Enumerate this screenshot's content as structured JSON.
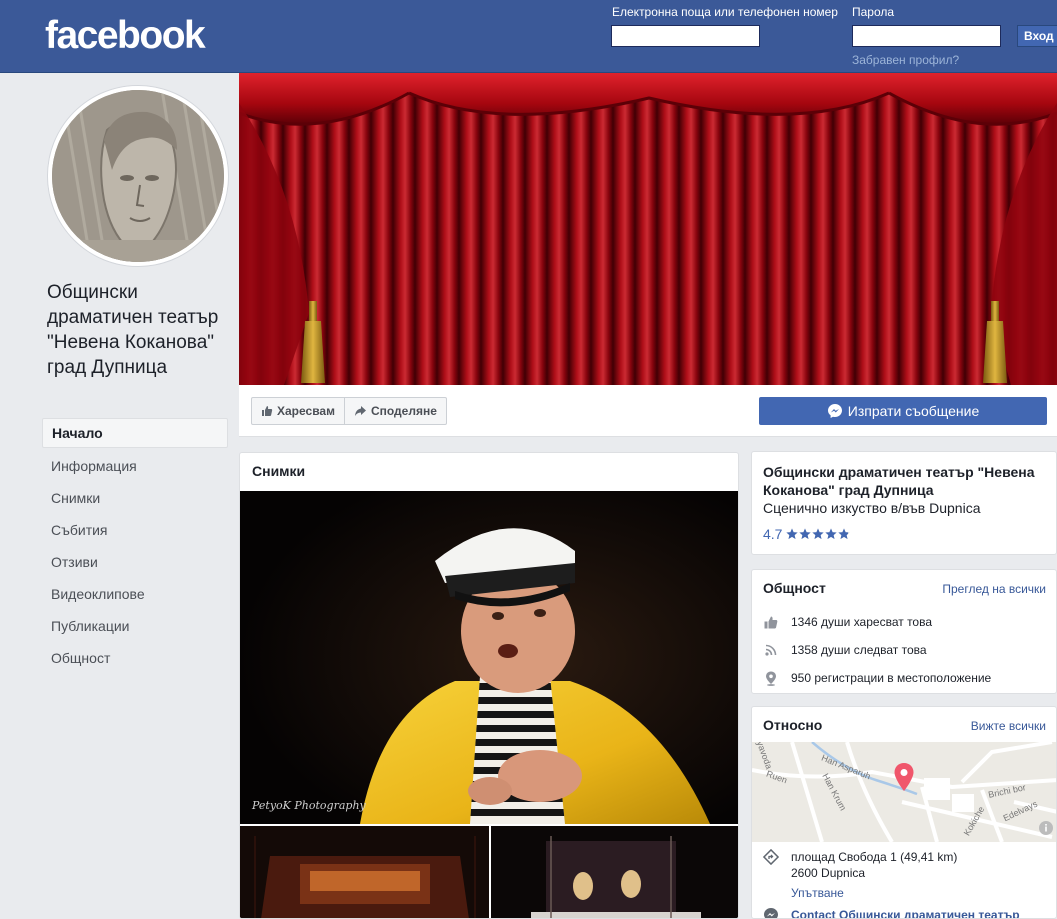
{
  "header": {
    "logo": "facebook",
    "email_label": "Електронна поща или телефонен номер",
    "password_label": "Парола",
    "forgot_link": "Забравен профил?",
    "login_button": "Вход"
  },
  "page": {
    "name": "Общински драматичен театър \"Невена Коканова\" град Дупница"
  },
  "nav": {
    "items": [
      {
        "label": "Начало"
      },
      {
        "label": "Информация"
      },
      {
        "label": "Снимки"
      },
      {
        "label": "Събития"
      },
      {
        "label": "Отзиви"
      },
      {
        "label": "Видеоклипове"
      },
      {
        "label": "Публикации"
      },
      {
        "label": "Общност"
      }
    ]
  },
  "actions": {
    "like_label": "Харесвам",
    "share_label": "Споделяне",
    "message_label": "Изпрати съобщение"
  },
  "photos": {
    "title": "Снимки",
    "watermark": "PetyoK Photography"
  },
  "info": {
    "title": "Общински драматичен театър \"Невена Коканова\" град Дупница",
    "category": "Сценично изкуство в/във Dupnica",
    "rating": "4.7",
    "rating_fraction": 0.94
  },
  "community": {
    "title": "Общност",
    "see_all": "Преглед на всички",
    "likes": "1346 души харесват това",
    "follows": "1358 души следват това",
    "checkins": "950 регистрации в местоположение"
  },
  "about": {
    "title": "Относно",
    "see_all": "Вижте всички",
    "address_line1": "площад Свобода 1 (49,41 km)",
    "address_line2": "2600 Dupnica",
    "directions": "Упътване",
    "contact": "Contact Общински драматичен театър",
    "map_labels": {
      "han_asparuh": "Han Asparuh",
      "han_krum": "Han Krum",
      "ruen": "Ruen",
      "brichi_bor": "Brichi bor",
      "edelvays": "Edelvays",
      "kokiche": "Kokiche",
      "yavoda": "yavoda"
    }
  },
  "colors": {
    "brand": "#3b5998",
    "button": "#4267b2",
    "link": "#385898",
    "background": "#e9ebee",
    "pin": "#f0566b"
  }
}
